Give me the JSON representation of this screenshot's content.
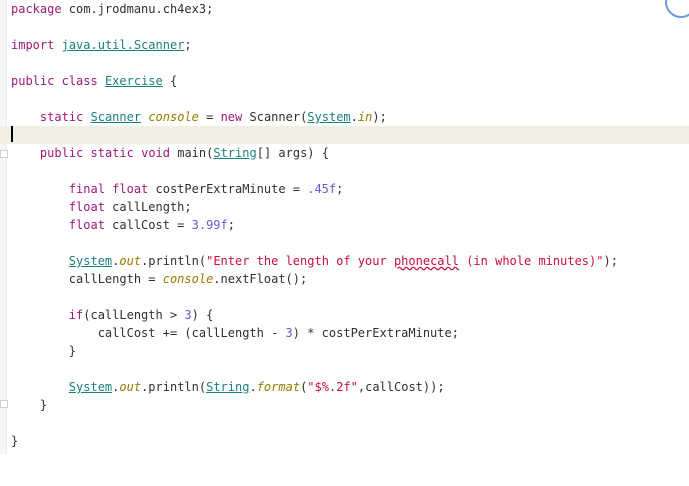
{
  "editor": {
    "lines": {
      "l1": {
        "kw": "package",
        "rest": " com.jrodmanu.ch4ex3;"
      },
      "l3": {
        "kw": "import",
        "sp": " ",
        "pkg": "java.util.Scanner",
        "end": ";"
      },
      "l5": {
        "kw1": "public",
        "sp1": " ",
        "kw2": "class",
        "sp2": " ",
        "cls": "Exercise",
        "end": " {"
      },
      "l7": {
        "indent": "    ",
        "kw": "static",
        "sp": " ",
        "cls": "Scanner",
        "sp2": " ",
        "fld": "console",
        "eq": " = ",
        "kw2": "new",
        "mid": " Scanner(",
        "cls2": "System",
        "dot": ".",
        "fld2": "in",
        "end": ");"
      },
      "l9": {
        "indent": "    ",
        "kw1": "public",
        "sp1": " ",
        "kw2": "static",
        "sp2": " ",
        "kw3": "void",
        "mid": " main(",
        "cls": "String",
        "end": "[] args) {"
      },
      "l11": {
        "indent": "        ",
        "kw1": "final",
        "sp1": " ",
        "kw2": "float",
        "mid": " costPerExtraMinute = ",
        "num": ".45f",
        "end": ";"
      },
      "l12": {
        "indent": "        ",
        "kw": "float",
        "rest": " callLength;"
      },
      "l13": {
        "indent": "        ",
        "kw": "float",
        "mid": " callCost = ",
        "num": "3.99f",
        "end": ";"
      },
      "l15": {
        "indent": "        ",
        "cls": "System",
        "dot": ".",
        "fld": "out",
        "mid": ".println(",
        "str1": "\"Enter the length of your ",
        "typo": "phonecall",
        "str2": " (in whole minutes)\"",
        "end": ");"
      },
      "l16": {
        "indent": "        ",
        "mid": "callLength = ",
        "fld": "console",
        "end": ".nextFloat();"
      },
      "l18": {
        "indent": "        ",
        "kw": "if",
        "mid": "(callLength > ",
        "num": "3",
        "end": ") {"
      },
      "l19": {
        "indent": "            ",
        "mid": "callCost += (callLength - ",
        "num": "3",
        "end": ") * costPerExtraMinute;"
      },
      "l20": {
        "indent": "        ",
        "end": "}"
      },
      "l22": {
        "indent": "        ",
        "cls": "System",
        "dot": ".",
        "fld": "out",
        "mid": ".println(",
        "cls2": "String",
        "dot2": ".",
        "fld2": "format",
        "p": "(",
        "str": "\"$%.2f\"",
        "end": ",callCost));"
      },
      "l23": {
        "indent": "    ",
        "end": "}"
      },
      "l25": {
        "end": "}"
      }
    }
  }
}
